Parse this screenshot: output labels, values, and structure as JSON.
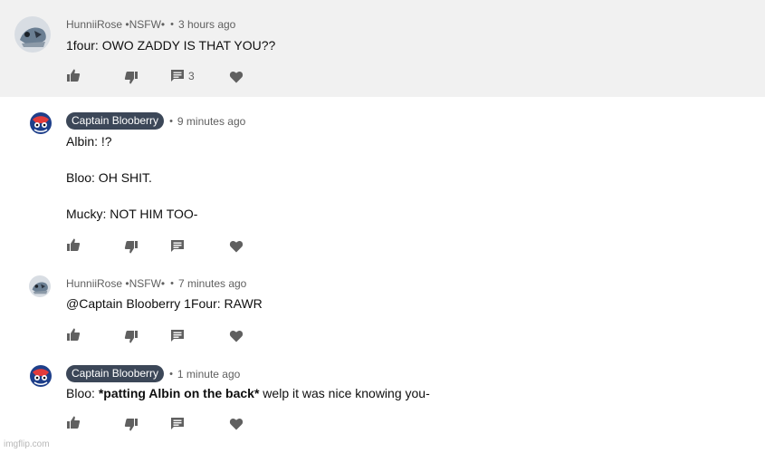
{
  "comments": [
    {
      "author": "HunniiRose •NSFW•",
      "separator": "•",
      "time": "3 hours ago",
      "lines": [
        "1four: OWO ZADDY IS THAT YOU??"
      ],
      "reply_count": "3",
      "highlighted": true,
      "author_pill": false
    },
    {
      "author": "Captain Blooberry",
      "separator": "•",
      "time": "9 minutes ago",
      "lines": [
        "Albin: !?",
        "Bloo: OH SHIT.",
        "Mucky: NOT HIM TOO-"
      ],
      "reply_count": "",
      "highlighted": false,
      "author_pill": true
    },
    {
      "author": "HunniiRose •NSFW•",
      "separator": "•",
      "time": "7 minutes ago",
      "lines": [
        "@Captain Blooberry 1Four: RAWR"
      ],
      "reply_count": "",
      "highlighted": false,
      "author_pill": false
    },
    {
      "author": "Captain Blooberry",
      "separator": "•",
      "time": "1 minute ago",
      "line_parts": {
        "prefix": "Bloo: ",
        "bold": "*patting Albin on the back*",
        "suffix": " welp it was nice knowing you-"
      },
      "reply_count": "",
      "highlighted": false,
      "author_pill": true
    }
  ],
  "icons": {
    "like": "thumbs-up-icon",
    "dislike": "thumbs-down-icon",
    "reply": "comment-icon",
    "heart": "heart-icon"
  },
  "colors": {
    "highlight_bg": "#f1f1f1",
    "pill_bg": "#3c4758",
    "meta_text": "#606060",
    "icon": "#606060"
  },
  "watermark": "imgflip.com"
}
